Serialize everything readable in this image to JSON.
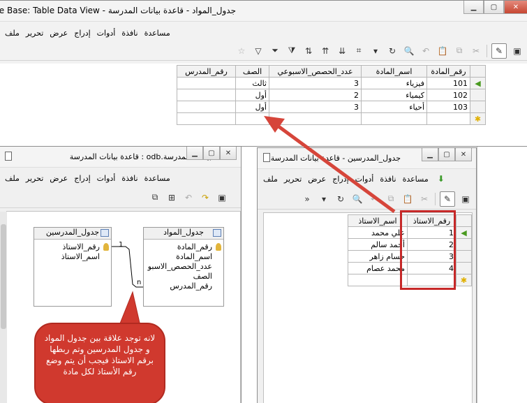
{
  "main": {
    "title": "جدول_المواد - قاعدة بيانات المدرسة - LibreOffice Base: Table Data View",
    "menu": [
      "ملف",
      "تحرير",
      "عرض",
      "إدراج",
      "أدوات",
      "نافذة",
      "مساعدة"
    ],
    "columns": [
      "رقم_المادة",
      "اسم_المادة",
      "عدد_الحصص_الاسبوعي",
      "الصف",
      "رقم_المدرس"
    ],
    "rows": [
      {
        "id": "101",
        "name": "فيزياء",
        "count": "3",
        "grade": "ثالث",
        "teacher": ""
      },
      {
        "id": "102",
        "name": "كيمياء",
        "count": "2",
        "grade": "أول",
        "teacher": ""
      },
      {
        "id": "103",
        "name": "أحياء",
        "count": "3",
        "grade": "أول",
        "teacher": ""
      }
    ]
  },
  "relwin": {
    "title": "قاعدة بيانات المدرسة.odb : قاعدة بيانات المدرسة",
    "menu": [
      "ملف",
      "تحرير",
      "عرض",
      "إدراج",
      "أدوات",
      "نافذة",
      "مساعدة"
    ],
    "teachers_table": {
      "title": "جدول_المدرسين",
      "fields": [
        "رقم_الاستاذ",
        "اسم_الاستاذ"
      ]
    },
    "subjects_table": {
      "title": "جدول_المواد",
      "fields": [
        "رقم_المادة",
        "اسم_المادة",
        "عدد_الحصص_الاسبو",
        "الصف",
        "رقم_المدرس"
      ]
    },
    "rel_one": "1",
    "rel_many": "n"
  },
  "teachwin": {
    "title": "جدول_المدرسين - قاعدة بيانات المدرسة",
    "menu": [
      "ملف",
      "تحرير",
      "عرض",
      "إدراج",
      "أدوات",
      "نافذة",
      "مساعدة"
    ],
    "overflow": "»",
    "columns": [
      "رقم_الاستاذ",
      "اسم_الاستاذ"
    ],
    "rows": [
      {
        "id": "1",
        "name": "علي محمد"
      },
      {
        "id": "2",
        "name": "أحمد سالم"
      },
      {
        "id": "3",
        "name": "حسام زاهر"
      },
      {
        "id": "4",
        "name": "محمد عصام"
      }
    ]
  },
  "callout": {
    "text": "لانه توجد علاقة بين جدول المواد و جدول المدرسين وتم ربطها برقم الاستاذ فيجب أن يتم وضع رقم الأستاذ لكل مادة"
  },
  "colors": {
    "arrow": "#d6453a",
    "highlight": "#c62828",
    "callout": "#d0392e"
  }
}
